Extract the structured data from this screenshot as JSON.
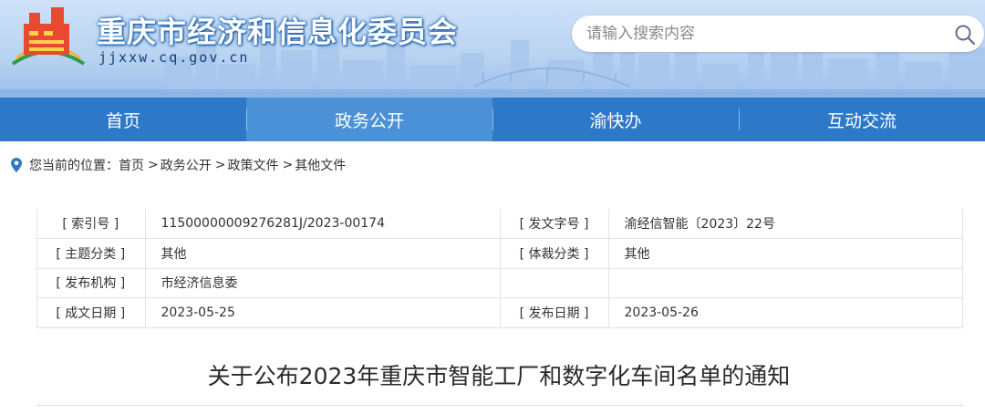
{
  "header": {
    "site_title": "重庆市经济和信息化委员会",
    "domain": "jjxxw.cq.gov.cn",
    "search_placeholder": "请输入搜索内容"
  },
  "nav": {
    "items": [
      {
        "label": "首页"
      },
      {
        "label": "政务公开"
      },
      {
        "label": "渝快办"
      },
      {
        "label": "互动交流"
      }
    ],
    "active_index": 1
  },
  "breadcrumb": {
    "prefix": "您当前的位置：",
    "items": [
      "首页",
      "政务公开",
      "政策文件",
      "其他文件"
    ],
    "separator": ">"
  },
  "info": {
    "rows": [
      {
        "label1": "[ 索引号 ]",
        "value1": "11500000009276281J/2023-00174",
        "label2": "[ 发文字号 ]",
        "value2": "渝经信智能〔2023〕22号"
      },
      {
        "label1": "[ 主题分类 ]",
        "value1": "其他",
        "label2": "[ 体裁分类 ]",
        "value2": "其他"
      },
      {
        "label1": "[ 发布机构 ]",
        "value1": "市经济信息委",
        "label2": "",
        "value2": ""
      },
      {
        "label1": "[ 成文日期 ]",
        "value1": "2023-05-25",
        "label2": "[ 发布日期 ]",
        "value2": "2023-05-26"
      }
    ]
  },
  "article": {
    "title": "关于公布2023年重庆市智能工厂和数字化车间名单的通知"
  },
  "colors": {
    "nav_bg": "#2e78c8",
    "nav_active": "#4a91d8",
    "banner_sky": "#cfe2f8"
  },
  "icons": [
    "logo-icon",
    "search-icon",
    "location-pin-icon"
  ]
}
